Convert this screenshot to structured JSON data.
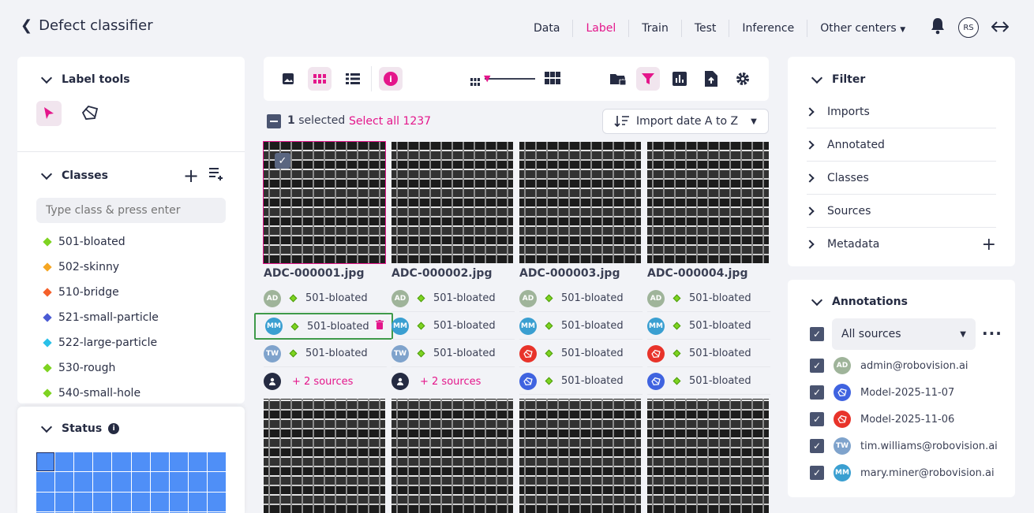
{
  "header": {
    "title": "Defect classifier",
    "nav": [
      "Data",
      "Label",
      "Train",
      "Test",
      "Inference",
      "Other centers"
    ],
    "active_nav": "Label",
    "user_initials": "RS"
  },
  "left": {
    "label_tools_title": "Label tools",
    "classes_title": "Classes",
    "class_input_placeholder": "Type class & press enter",
    "classes": [
      {
        "name": "501-bloated",
        "color": "#7ed321"
      },
      {
        "name": "502-skinny",
        "color": "#f5a623"
      },
      {
        "name": "510-bridge",
        "color": "#f5602a"
      },
      {
        "name": "521-small-particle",
        "color": "#4a5bd4"
      },
      {
        "name": "522-large-particle",
        "color": "#29c0e8"
      },
      {
        "name": "530-rough",
        "color": "#7ed321"
      },
      {
        "name": "540-small-hole",
        "color": "#7ed321"
      }
    ],
    "status_title": "Status"
  },
  "toolbar": {
    "selected_count": "1",
    "selected_label": "selected",
    "select_all": "Select all 1237",
    "sort_label": "Import date A to Z"
  },
  "images": [
    {
      "file": "ADC-000001.jpg",
      "annotations": [
        {
          "initials": "AD",
          "color": "#9fb49a",
          "label": "501-bloated"
        },
        {
          "initials": "MM",
          "color": "#3a9fd1",
          "label": "501-bloated"
        },
        {
          "initials": "TW",
          "color": "#7fa3cc",
          "label": "501-bloated"
        }
      ],
      "more": "+ 2 sources"
    },
    {
      "file": "ADC-000002.jpg",
      "annotations": [
        {
          "initials": "AD",
          "color": "#9fb49a",
          "label": "501-bloated"
        },
        {
          "initials": "MM",
          "color": "#3a9fd1",
          "label": "501-bloated"
        },
        {
          "initials": "TW",
          "color": "#7fa3cc",
          "label": "501-bloated"
        }
      ],
      "more": "+ 2 sources"
    },
    {
      "file": "ADC-000003.jpg",
      "annotations": [
        {
          "initials": "AD",
          "color": "#9fb49a",
          "label": "501-bloated"
        },
        {
          "initials": "MM",
          "color": "#3a9fd1",
          "label": "501-bloated"
        },
        {
          "initials": "",
          "color": "#e8332a",
          "label": "501-bloated"
        },
        {
          "initials": "",
          "color": "#3f63e0",
          "label": "501-bloated"
        }
      ]
    },
    {
      "file": "ADC-000004.jpg",
      "annotations": [
        {
          "initials": "AD",
          "color": "#9fb49a",
          "label": "501-bloated"
        },
        {
          "initials": "MM",
          "color": "#3a9fd1",
          "label": "501-bloated"
        },
        {
          "initials": "",
          "color": "#e8332a",
          "label": "501-bloated"
        },
        {
          "initials": "",
          "color": "#3f63e0",
          "label": "501-bloated"
        }
      ]
    }
  ],
  "filter": {
    "title": "Filter",
    "rows": [
      "Imports",
      "Annotated",
      "Classes",
      "Sources",
      "Metadata"
    ]
  },
  "annotations_panel": {
    "title": "Annotations",
    "source_select": "All sources",
    "sources": [
      {
        "initials": "AD",
        "color": "#9fb49a",
        "name": "admin@robovision.ai"
      },
      {
        "initials": "",
        "color": "#3f63e0",
        "name": "Model-2025-11-07"
      },
      {
        "initials": "",
        "color": "#e8332a",
        "name": "Model-2025-11-06"
      },
      {
        "initials": "TW",
        "color": "#7fa3cc",
        "name": "tim.williams@robovision.ai"
      },
      {
        "initials": "MM",
        "color": "#3a9fd1",
        "name": "mary.miner@robovision.ai"
      }
    ]
  },
  "colors": {
    "accent": "#e4168b",
    "status_blue": "#4f8ff7"
  }
}
